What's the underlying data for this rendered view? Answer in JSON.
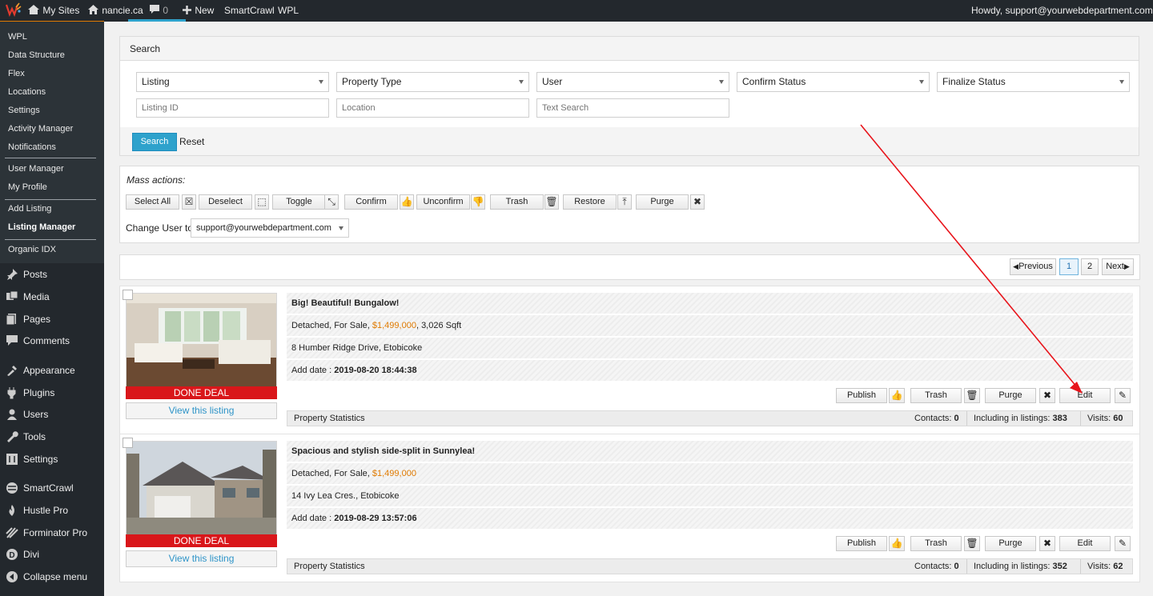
{
  "adminbar": {
    "my_sites": "My Sites",
    "site_name": "nancie.ca",
    "comments_count": "0",
    "new_label": "New",
    "smartcrawl": "SmartCrawl",
    "wpl": "WPL",
    "howdy": "Howdy, support@yourwebdepartment.com"
  },
  "sidebar": {
    "sub_items": [
      "WPL",
      "Data Structure",
      "Flex",
      "Locations",
      "Settings",
      "Activity Manager",
      "Notifications"
    ],
    "user_items": [
      "User Manager",
      "My Profile"
    ],
    "listing_items": [
      "Add Listing",
      "Listing Manager"
    ],
    "organic": "Organic IDX",
    "main_items": [
      {
        "label": "Posts",
        "icon": "pin-icon"
      },
      {
        "label": "Media",
        "icon": "media-icon"
      },
      {
        "label": "Pages",
        "icon": "pages-icon"
      },
      {
        "label": "Comments",
        "icon": "comments-icon"
      },
      {
        "label": "Appearance",
        "icon": "appearance-icon"
      },
      {
        "label": "Plugins",
        "icon": "plugins-icon"
      },
      {
        "label": "Users",
        "icon": "users-icon"
      },
      {
        "label": "Tools",
        "icon": "tools-icon"
      },
      {
        "label": "Settings",
        "icon": "settings-icon"
      },
      {
        "label": "SmartCrawl",
        "icon": "smartcrawl-icon"
      },
      {
        "label": "Hustle Pro",
        "icon": "hustle-icon"
      },
      {
        "label": "Forminator Pro",
        "icon": "forminator-icon"
      },
      {
        "label": "Divi",
        "icon": "divi-icon"
      },
      {
        "label": "Collapse menu",
        "icon": "collapse-icon"
      }
    ]
  },
  "search": {
    "title": "Search",
    "selects": [
      "Listing",
      "Property Type",
      "User",
      "Confirm Status",
      "Finalize Status"
    ],
    "listing_id_placeholder": "Listing ID",
    "location_placeholder": "Location",
    "text_search_placeholder": "Text Search",
    "search_button": "Search",
    "reset_button": "Reset"
  },
  "mass_actions": {
    "title": "Mass actions:",
    "buttons": [
      "Select All",
      "Deselect",
      "Toggle",
      "Confirm",
      "Unconfirm",
      "Trash",
      "Restore",
      "Purge"
    ],
    "change_user_label": "Change User to",
    "change_user_value": "support@yourwebdepartment.com"
  },
  "pagination": {
    "previous": "Previous",
    "pages": [
      "1",
      "2"
    ],
    "next": "Next",
    "current": "1"
  },
  "listings": [
    {
      "title": "Big! Beautiful! Bungalow!",
      "details_prefix": "Detached, For Sale, ",
      "price": "$1,499,000",
      "details_suffix": ", 3,026 Sqft",
      "address": "8 Humber Ridge Drive, Etobicoke",
      "add_date_label": "Add date : ",
      "add_date": "2019-08-20 18:44:38",
      "status": "DONE DEAL",
      "view_link": "View this listing",
      "actions": [
        "Publish",
        "Trash",
        "Purge",
        "Edit"
      ],
      "stats_label": "Property Statistics",
      "contacts_label": "Contacts: ",
      "contacts": "0",
      "including_label": "Including in listings: ",
      "including": "383",
      "visits_label": "Visits: ",
      "visits": "60"
    },
    {
      "title": "Spacious and stylish side-split in Sunnylea!",
      "details_prefix": "Detached, For Sale, ",
      "price": "$1,499,000",
      "details_suffix": "",
      "address": "14 Ivy Lea Cres., Etobicoke",
      "add_date_label": "Add date : ",
      "add_date": "2019-08-29 13:57:06",
      "status": "DONE DEAL",
      "view_link": "View this listing",
      "actions": [
        "Publish",
        "Trash",
        "Purge",
        "Edit"
      ],
      "stats_label": "Property Statistics",
      "contacts_label": "Contacts: ",
      "contacts": "0",
      "including_label": "Including in listings: ",
      "including": "352",
      "visits_label": "Visits: ",
      "visits": "62"
    }
  ],
  "colors": {
    "adminbar": "#23282d",
    "accent_orange": "#e07a00",
    "primary_blue": "#2ea2cc",
    "done_deal_red": "#d9161a",
    "annotation_arrow": "#e8141b"
  }
}
